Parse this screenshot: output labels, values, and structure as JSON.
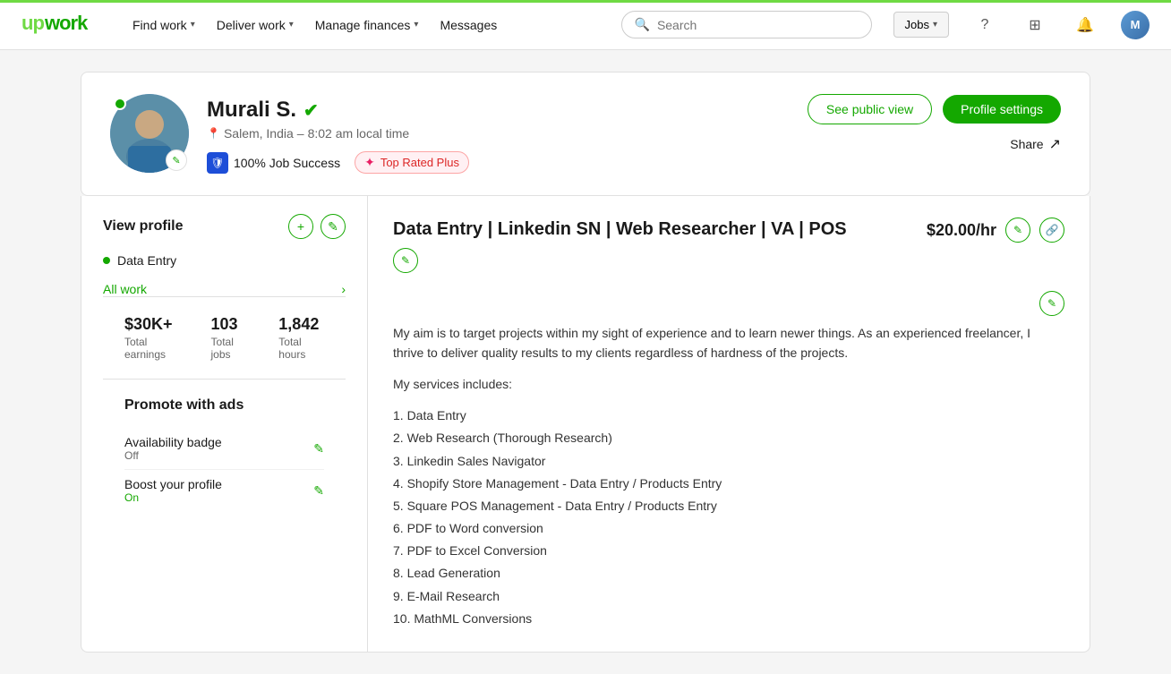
{
  "app": {
    "logo": "upwork"
  },
  "navbar": {
    "links": [
      {
        "id": "find-work",
        "label": "Find work",
        "has_dropdown": true
      },
      {
        "id": "deliver-work",
        "label": "Deliver work",
        "has_dropdown": true
      },
      {
        "id": "manage-finances",
        "label": "Manage finances",
        "has_dropdown": true
      },
      {
        "id": "messages",
        "label": "Messages",
        "has_dropdown": false
      }
    ],
    "search_placeholder": "Search",
    "jobs_dropdown_label": "Jobs",
    "help_icon": "?",
    "grid_icon": "⊞",
    "bell_icon": "🔔",
    "user_initials": "M"
  },
  "profile": {
    "name": "Murali S.",
    "verified": true,
    "location": "Salem, India",
    "local_time": "8:02 am local time",
    "online": true,
    "job_success": "100% Job Success",
    "badge": "Top Rated Plus",
    "see_public_view_label": "See public view",
    "profile_settings_label": "Profile settings",
    "share_label": "Share"
  },
  "sidebar": {
    "view_profile_label": "View profile",
    "add_icon": "+",
    "edit_icon": "✎",
    "items": [
      {
        "id": "data-entry",
        "label": "Data Entry",
        "active": true
      }
    ],
    "all_work_label": "All work"
  },
  "stats": [
    {
      "id": "earnings",
      "value": "$30K+",
      "label": "Total earnings"
    },
    {
      "id": "jobs",
      "value": "103",
      "label": "Total jobs"
    },
    {
      "id": "hours",
      "value": "1,842",
      "label": "Total hours"
    }
  ],
  "promote": {
    "title": "Promote with ads",
    "items": [
      {
        "id": "availability-badge",
        "name": "Availability badge",
        "status": "Off",
        "status_on": false
      },
      {
        "id": "boost-profile",
        "name": "Boost your profile",
        "status": "On",
        "status_on": true
      }
    ]
  },
  "main": {
    "job_title": "Data Entry | Linkedin SN | Web Researcher | VA | POS",
    "rate": "$20.00/hr",
    "bio_intro": "My aim is to target projects within my sight of experience and to learn newer things. As an experienced freelancer, I thrive to deliver quality results to my clients regardless of hardness of the projects.",
    "bio_services_header": "My services includes:",
    "services": [
      "1. Data Entry",
      "2. Web Research (Thorough Research)",
      "3. Linkedin Sales Navigator",
      "4. Shopify Store Management - Data Entry / Products Entry",
      "5. Square POS Management - Data Entry / Products Entry",
      "6. PDF to Word conversion",
      "7. PDF to Excel Conversion",
      "8. Lead Generation",
      "9. E-Mail Research",
      "10. MathML Conversions"
    ]
  }
}
